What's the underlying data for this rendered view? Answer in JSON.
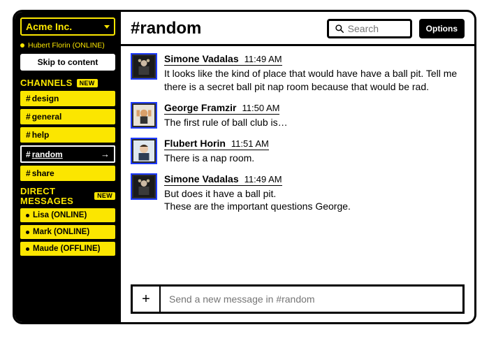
{
  "workspace": {
    "name": "Acme Inc."
  },
  "user": {
    "presence_line": "Hubert Florin (ONLINE)"
  },
  "skip_label": "Skip to content",
  "channels": {
    "heading": "CHANNELS",
    "badge": "NEW",
    "items": [
      {
        "name": "design",
        "label": "design",
        "active": false
      },
      {
        "name": "general",
        "label": "general",
        "active": false
      },
      {
        "name": "help",
        "label": "help",
        "active": false
      },
      {
        "name": "random",
        "label": "random",
        "active": true
      },
      {
        "name": "share",
        "label": "share",
        "active": false
      }
    ]
  },
  "dms": {
    "heading": "DIRECT MESSAGES",
    "badge": "NEW",
    "items": [
      {
        "label": "Lisa (ONLINE)"
      },
      {
        "label": "Mark (ONLINE)"
      },
      {
        "label": "Maude (OFFLINE)"
      }
    ]
  },
  "header": {
    "channel_title": "#random",
    "search_placeholder": "Search",
    "options_label": "Options"
  },
  "messages": [
    {
      "author": "Simone Vadalas",
      "time": "11:49 AM",
      "text": "It looks like the kind of place that would have have a ball pit. Tell me there is a secret ball pit nap room because that would be rad.",
      "avatar": "dark"
    },
    {
      "author": "George Framzir",
      "time": "11:50 AM",
      "text": "The first rule of ball club is…",
      "avatar": "hands"
    },
    {
      "author": "Flubert Horin",
      "time": "11:51 AM",
      "text": "There is a nap room.",
      "avatar": "face"
    },
    {
      "author": "Simone Vadalas",
      "time": "11:49 AM",
      "text": "But does it have a ball pit.\nThese are the important questions George.",
      "avatar": "dark"
    }
  ],
  "composer": {
    "placeholder": "Send a new message in #random"
  }
}
